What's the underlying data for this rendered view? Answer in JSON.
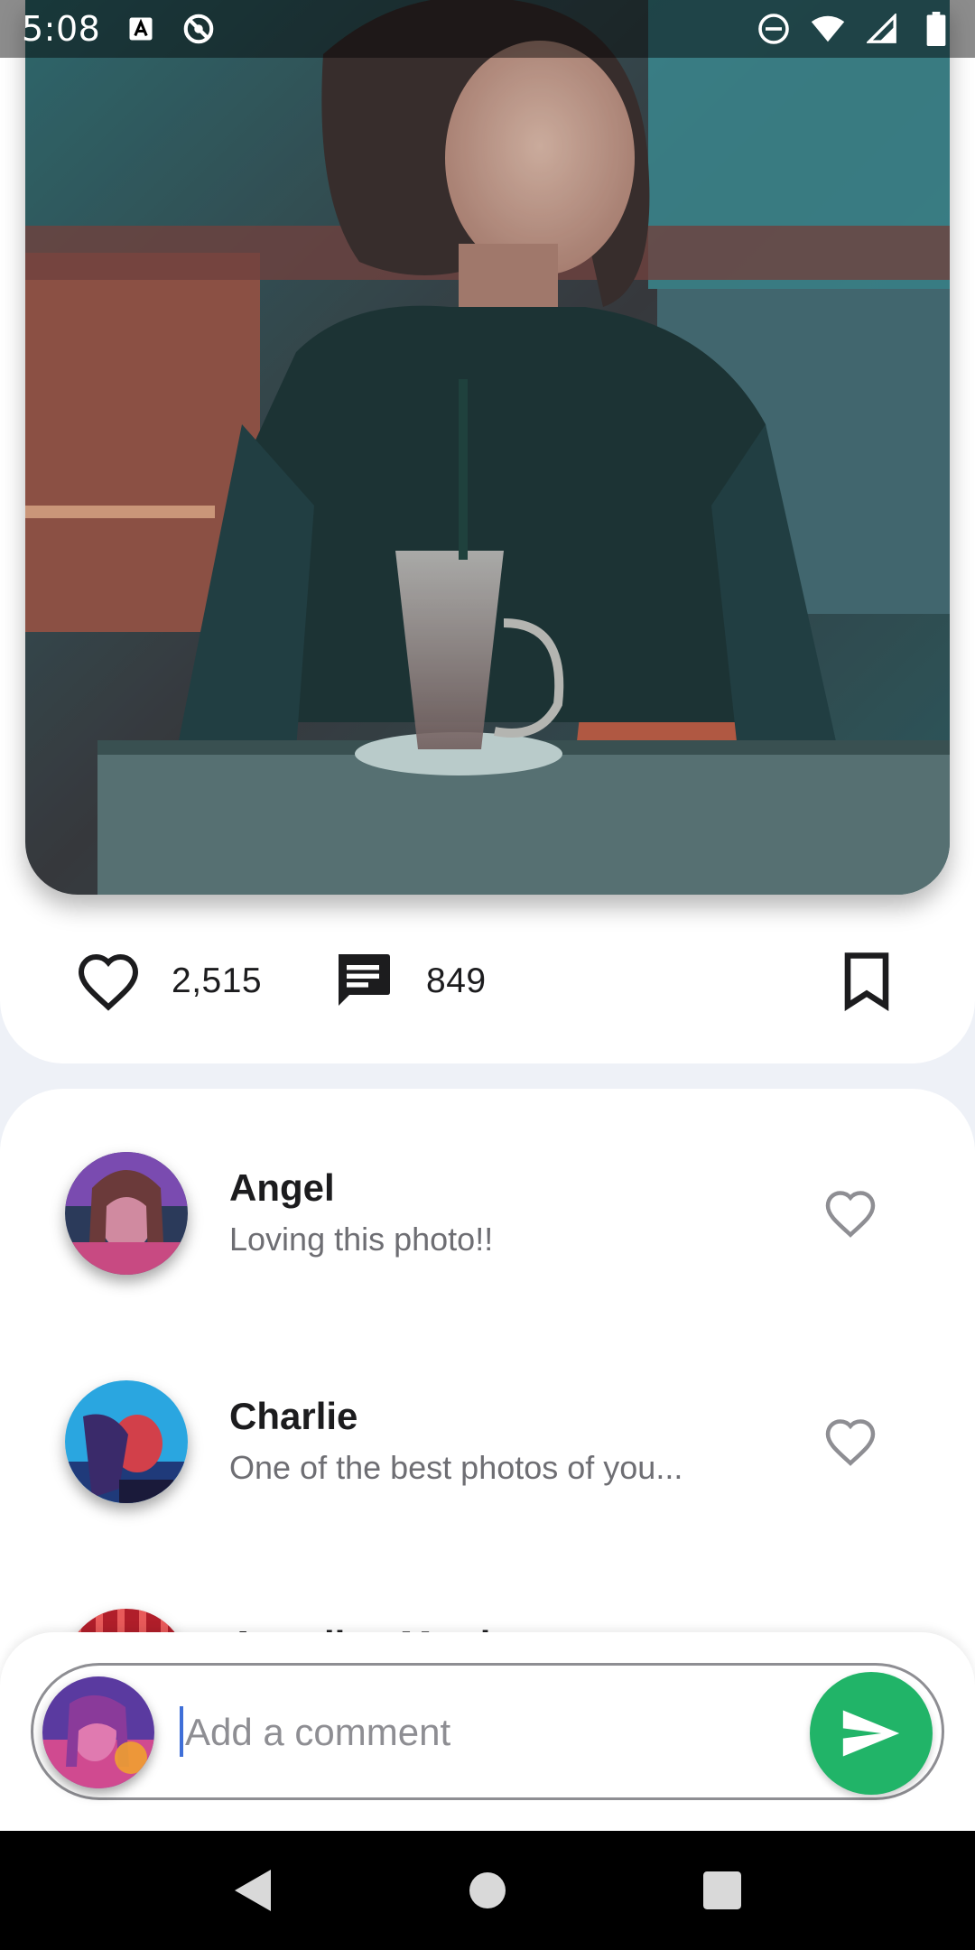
{
  "status_bar": {
    "time": "5:08",
    "left_icons": [
      "font-a-icon",
      "sync-icon"
    ],
    "right_icons": [
      "do-not-disturb-icon",
      "wifi-icon",
      "signal-icon",
      "battery-icon"
    ]
  },
  "post": {
    "likes": "2,515",
    "comments": "849",
    "icons": {
      "like": "heart-outline-icon",
      "comments": "chat-icon",
      "bookmark": "bookmark-icon"
    }
  },
  "comments": [
    {
      "name": "Angel",
      "text": "Loving this photo!!"
    },
    {
      "name": "Charlie",
      "text": "One of the best photos of you..."
    },
    {
      "name": "Angelina Martin",
      "text": ""
    }
  ],
  "composer": {
    "placeholder": "Add a comment",
    "value": ""
  },
  "colors": {
    "accent": "#21b468",
    "background": "#eef1f7",
    "card": "#ffffff",
    "text_primary": "#1c1c1e",
    "text_secondary": "#6e6e73"
  }
}
